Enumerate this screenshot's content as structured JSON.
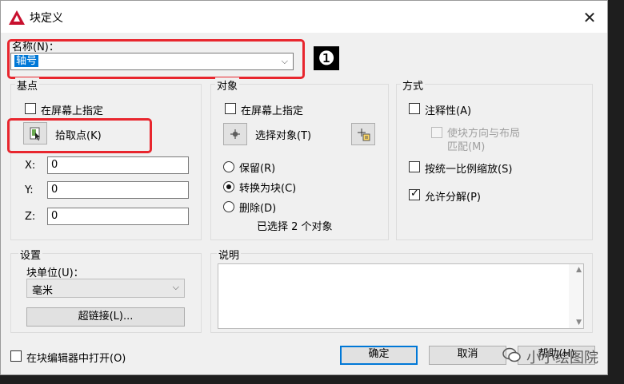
{
  "window": {
    "title": "块定义",
    "close": "✕"
  },
  "name": {
    "label": "名称(N)：",
    "value": "轴号"
  },
  "annotation_number": "❶",
  "basepoint": {
    "title": "基点",
    "specify_on_screen": "在屏幕上指定",
    "pick_point": "拾取点(K)",
    "x_label": "X:",
    "x_value": "0",
    "y_label": "Y:",
    "y_value": "0",
    "z_label": "Z:",
    "z_value": "0"
  },
  "objects": {
    "title": "对象",
    "specify_on_screen": "在屏幕上指定",
    "select_objects": "选择对象(T)",
    "retain": "保留(R)",
    "convert_to_block": "转换为块(C)",
    "delete": "删除(D)",
    "selected_count": "已选择 2 个对象",
    "selected_option": "convert_to_block"
  },
  "behavior": {
    "title": "方式",
    "annotative": "注释性(A)",
    "match_orientation_line1": "使块方向与布局",
    "match_orientation_line2": "匹配(M)",
    "scale_uniformly": "按统一比例缩放(S)",
    "allow_exploding": "允许分解(P)",
    "allow_exploding_checked": true
  },
  "settings": {
    "title": "设置",
    "block_unit_label": "块单位(U)：",
    "block_unit_value": "毫米",
    "hyperlink": "超链接(L)..."
  },
  "description": {
    "title": "说明",
    "value": ""
  },
  "footer": {
    "open_in_editor": "在块编辑器中打开(O)",
    "ok": "确定",
    "cancel": "取消",
    "help": "帮助(H)"
  },
  "watermark": "小小绘图院",
  "colors": {
    "highlight_red": "#e8262e",
    "accent_blue": "#0078d7",
    "selection": "#0078d7"
  }
}
